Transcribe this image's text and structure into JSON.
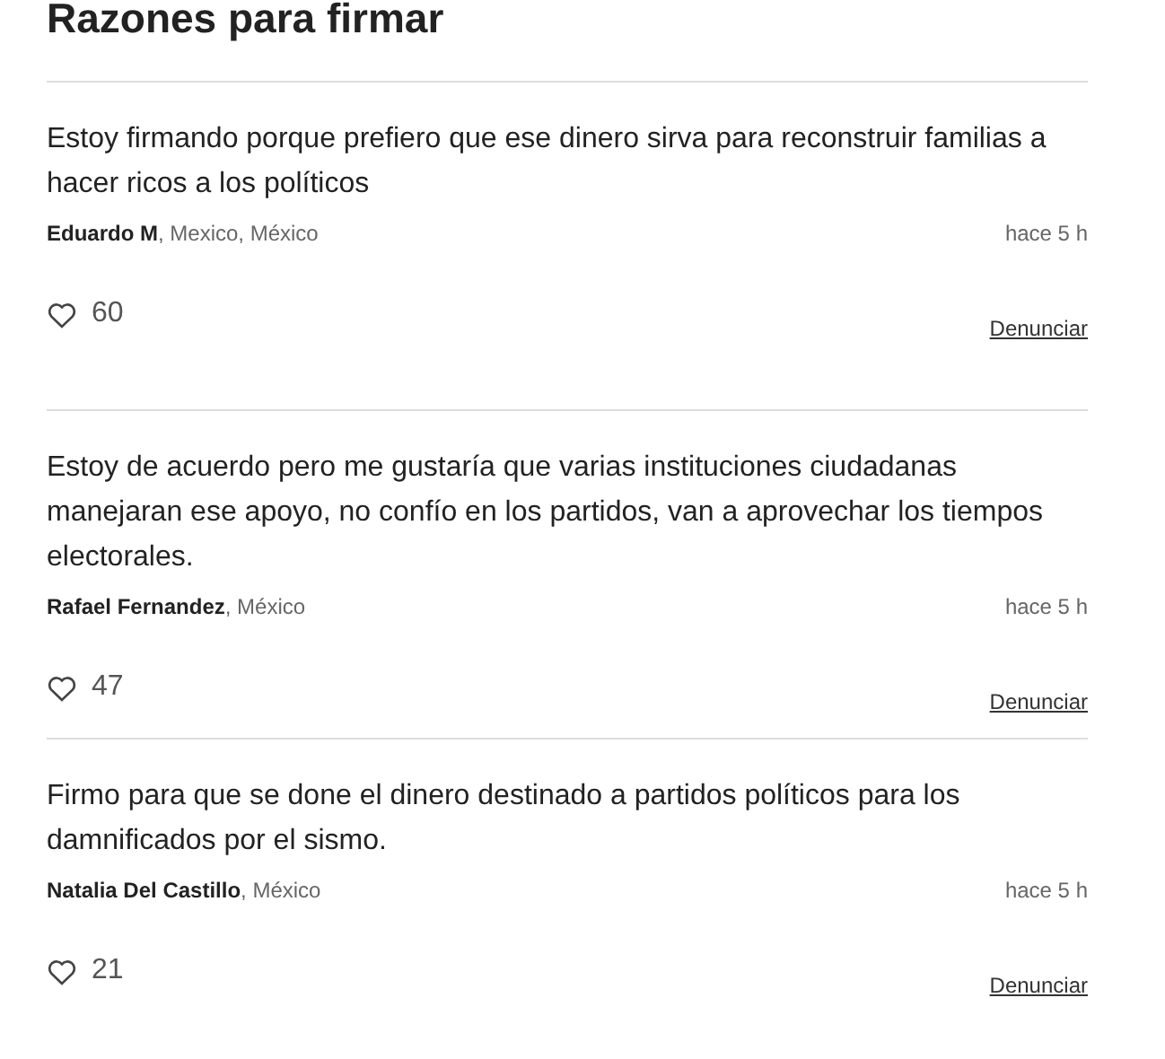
{
  "title": "Razones para firmar",
  "comments": [
    {
      "text": "Estoy firmando porque prefiero que ese dinero sirva para reconstruir familias a hacer ricos a los políticos",
      "author": "Eduardo M",
      "location": ", Mexico, México",
      "time": "hace 5 h",
      "likes": "60",
      "report": "Denunciar"
    },
    {
      "text": "Estoy de acuerdo pero me gustaría que varias instituciones ciudadanas manejaran ese apoyo, no confío en los partidos, van a aprovechar los tiempos electorales.",
      "author": "Rafael Fernandez",
      "location": ", México",
      "time": "hace 5 h",
      "likes": "47",
      "report": "Denunciar"
    },
    {
      "text": "Firmo para que se done el dinero destinado a partidos políticos para los damnificados por el sismo.",
      "author": "Natalia Del Castillo",
      "location": ", México",
      "time": "hace 5 h",
      "likes": "21",
      "report": "Denunciar"
    }
  ]
}
